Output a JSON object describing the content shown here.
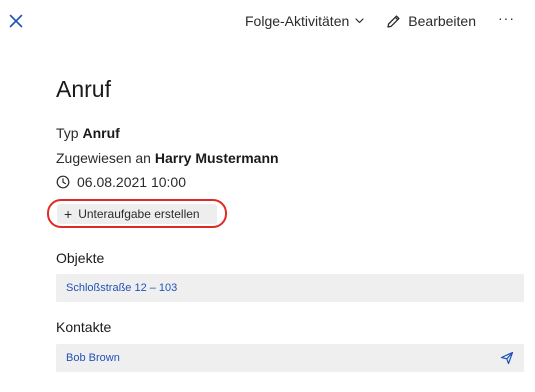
{
  "topbar": {
    "followup_label": "Folge-Aktivitäten",
    "edit_label": "Bearbeiten",
    "more_label": "···"
  },
  "activity": {
    "title": "Anruf",
    "type_prefix": "Typ",
    "type_value": "Anruf",
    "assigned_prefix": "Zugewiesen an",
    "assigned_value": "Harry Mustermann",
    "datetime": "06.08.2021 10:00"
  },
  "actions": {
    "create_subtask_label": "Unteraufgabe erstellen"
  },
  "objects": {
    "heading": "Objekte",
    "items": [
      {
        "label": "Schloßstraße 12 – 103"
      }
    ]
  },
  "contacts": {
    "heading": "Kontakte",
    "items": [
      {
        "label": "Bob Brown"
      }
    ]
  },
  "colors": {
    "accent_blue": "#2152b8",
    "highlight_red": "#e02b25",
    "box_gray": "#efefef"
  },
  "icons": {
    "close": "close-icon",
    "chevron": "chevron-down-icon",
    "edit": "pencil-icon",
    "clock": "clock-icon",
    "plus": "plus-icon",
    "send": "send-icon"
  }
}
